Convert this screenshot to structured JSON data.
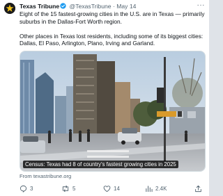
{
  "post": {
    "author_name": "Texas Tribune",
    "handle": "@TexasTribune",
    "separator": "·",
    "date": "May 14",
    "more_label": "···",
    "paragraph_1": "Eight of the 15 fastest-growing cities in the U.S. are in Texas — primarily suburbs in the Dallas-Fort Worth region.",
    "paragraph_2": "Other places in Texas lost residents, including some of its biggest cities: Dallas, El Paso, Arlington, Plano, Irving and Garland.",
    "media_caption": "Census: Texas had 8 of country's fastest growing cities in 2025",
    "link_source": "From texastribune.org"
  },
  "actions": {
    "replies": "3",
    "reposts": "5",
    "likes": "14",
    "views": "2.4K"
  },
  "icons": {
    "avatar": "texas-star-icon",
    "verified": "verified-badge-icon",
    "reply": "reply-icon",
    "repost": "repost-icon",
    "like": "heart-icon",
    "views": "views-chart-icon",
    "share": "share-icon"
  },
  "colors": {
    "text": "#0f1419",
    "muted": "#536471",
    "verified": "#1d9bf0",
    "avatar_bg": "#1b1b1b",
    "avatar_star": "#f2c21a"
  }
}
